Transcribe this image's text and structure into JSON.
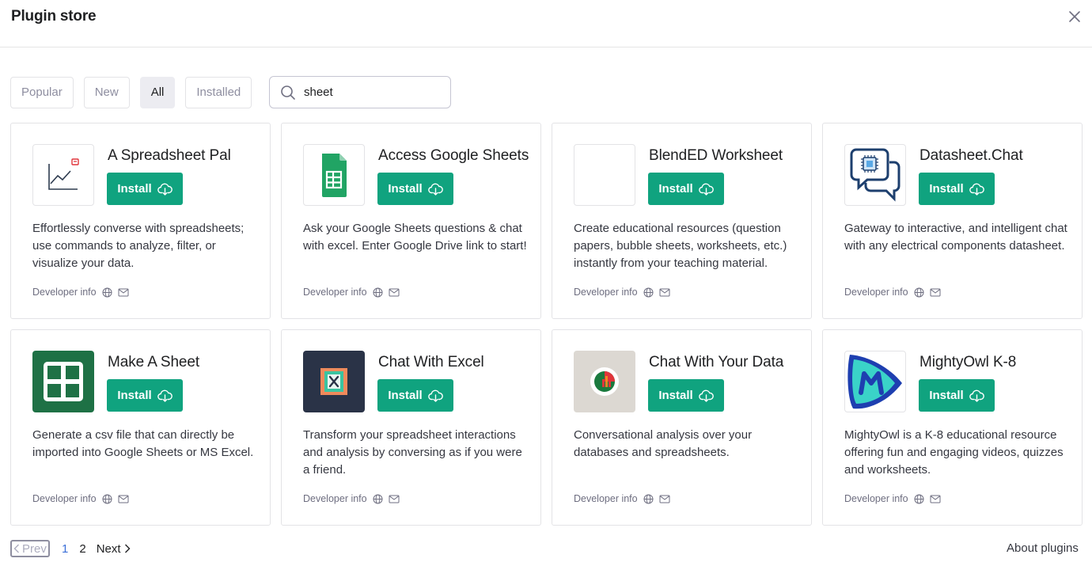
{
  "header": {
    "title": "Plugin store"
  },
  "filters": {
    "tabs": [
      {
        "label": "Popular",
        "active": false
      },
      {
        "label": "New",
        "active": false
      },
      {
        "label": "All",
        "active": true
      },
      {
        "label": "Installed",
        "active": false
      }
    ]
  },
  "search": {
    "value": "sheet"
  },
  "install_label": "Install",
  "developer_info_label": "Developer info",
  "plugins": [
    {
      "name": "A Spreadsheet Pal",
      "description": "Effortlessly converse with spreadsheets; use commands to analyze, filter, or visualize your data.",
      "logo": "line-chart-icon"
    },
    {
      "name": "Access Google Sheets",
      "description": "Ask your Google Sheets questions & chat with excel. Enter Google Drive link to start!",
      "logo": "google-sheets-icon"
    },
    {
      "name": "BlendED Worksheet",
      "description": "Create educational resources (question papers, bubble sheets, worksheets, etc.) instantly from your teaching material.",
      "logo": "blank-logo"
    },
    {
      "name": "Datasheet.Chat",
      "description": "Gateway to interactive, and intelligent chat with any electrical components datasheet.",
      "logo": "chip-chat-icon"
    },
    {
      "name": "Make A Sheet",
      "description": "Generate a csv file that can directly be imported into Google Sheets or MS Excel.",
      "logo": "grid-icon"
    },
    {
      "name": "Chat With Excel",
      "description": "Transform your spreadsheet interactions and analysis by conversing as if you were a friend.",
      "logo": "excel-chat-icon"
    },
    {
      "name": "Chat With Your Data",
      "description": "Conversational analysis over your databases and spreadsheets.",
      "logo": "data-pie-icon"
    },
    {
      "name": "MightyOwl K-8",
      "description": "MightyOwl is a K-8 educational resource offering fun and engaging videos, quizzes and worksheets.",
      "logo": "mightyowl-icon"
    }
  ],
  "pagination": {
    "prev": "Prev",
    "pages": [
      "1",
      "2"
    ],
    "current": "1",
    "next": "Next"
  },
  "footer": {
    "about": "About plugins"
  },
  "colors": {
    "install": "#10a37f",
    "current_page": "#3b6fd8",
    "sheets_green": "#21a464",
    "make_sheet_green": "#1e7145",
    "excel_dark": "#2a3347",
    "owl_blue": "#1e3fb0"
  }
}
